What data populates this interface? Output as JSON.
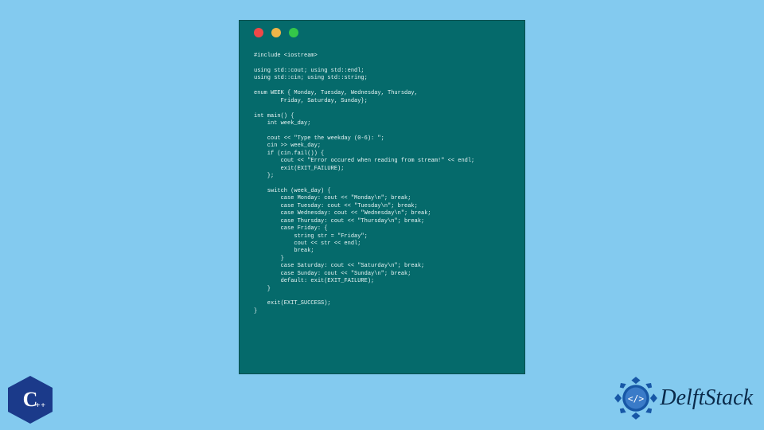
{
  "colors": {
    "background": "#83caef",
    "window_bg": "#056a6b",
    "dot_red": "#f04848",
    "dot_yellow": "#f0b548",
    "dot_green": "#34c749"
  },
  "code": "#include <iostream>\n\nusing std::cout; using std::endl;\nusing std::cin; using std::string;\n\nenum WEEK { Monday, Tuesday, Wednesday, Thursday,\n        Friday, Saturday, Sunday};\n\nint main() {\n    int week_day;\n\n    cout << \"Type the weekday (0-6): \";\n    cin >> week_day;\n    if (cin.fail()) {\n        cout << \"Error occured when reading from stream!\" << endl;\n        exit(EXIT_FAILURE);\n    };\n\n    switch (week_day) {\n        case Monday: cout << \"Monday\\n\"; break;\n        case Tuesday: cout << \"Tuesday\\n\"; break;\n        case Wednesday: cout << \"Wednesday\\n\"; break;\n        case Thursday: cout << \"Thursday\\n\"; break;\n        case Friday: {\n            string str = \"Friday\";\n            cout << str << endl;\n            break;\n        }\n        case Saturday: cout << \"Saturday\\n\"; break;\n        case Sunday: cout << \"Sunday\\n\"; break;\n        default: exit(EXIT_FAILURE);\n    }\n\n    exit(EXIT_SUCCESS);\n}",
  "cpp_logo": {
    "letter": "C",
    "plus": "++"
  },
  "brand": {
    "name": "DelftStack"
  }
}
